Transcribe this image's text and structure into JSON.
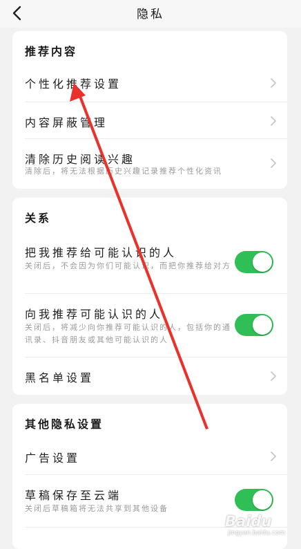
{
  "header": {
    "title": "隐私"
  },
  "sections": [
    {
      "title": "推荐内容",
      "rows": [
        {
          "title": "个性化推荐设置"
        },
        {
          "title": "内容屏蔽管理"
        },
        {
          "title": "清除历史阅读兴趣",
          "desc": "清除后，将无法根据历史兴趣记录推荐个性化资讯"
        }
      ]
    },
    {
      "title": "关系",
      "rows": [
        {
          "title": "把我推荐给可能认识的人",
          "desc": "关闭后，不会因为你们可能认识，而把你推荐给对方",
          "toggle_on": true
        },
        {
          "title": "向我推荐可能认识的人",
          "desc": "关闭后，将减少向你推荐可能认识的人，包括你的通讯录、抖音朋友或其他可能认识的人",
          "toggle_on": true
        },
        {
          "title": "黑名单设置"
        }
      ]
    },
    {
      "title": "其他隐私设置",
      "rows": [
        {
          "title": "广告设置"
        },
        {
          "title": "草稿保存至云端",
          "desc": "关闭后草稿箱将无法共享到其他设备",
          "toggle_on": true
        }
      ]
    }
  ],
  "watermark": {
    "brand": "Baidu",
    "url": "jingyan.baidu.com"
  },
  "colors": {
    "toggle_on": "#2fbf56",
    "annotation_arrow": "#e8322b",
    "background": "#f2f2f2"
  }
}
